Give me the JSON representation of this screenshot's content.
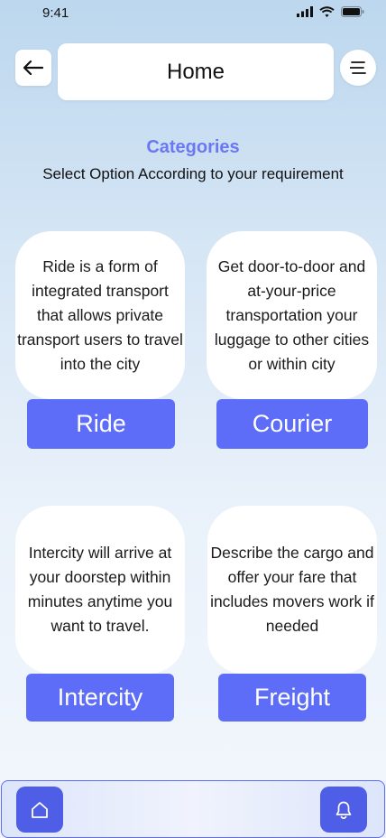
{
  "status_bar": {
    "time": "9:41",
    "icons": [
      "signal-icon",
      "wifi-icon",
      "battery-icon"
    ]
  },
  "header": {
    "title": "Home",
    "back_icon": "arrow-left-icon",
    "menu_icon": "hamburger-menu-icon"
  },
  "categories": {
    "title": "Categories",
    "subtitle": "Select Option According to your requirement",
    "items": [
      {
        "description": "Ride is a form of integrated transport that allows private transport users to travel into the city",
        "button_label": "Ride"
      },
      {
        "description": "Get door-to-door and at-your-price transportation your luggage to other cities or within city",
        "button_label": "Courier"
      },
      {
        "description": "Intercity will arrive at your doorstep within minutes anytime you want to travel.",
        "button_label": "Intercity"
      },
      {
        "description": "Describe the cargo and offer your fare that includes movers work if needed",
        "button_label": "Freight"
      }
    ]
  },
  "bottom_nav": {
    "home_icon": "home-icon",
    "notification_icon": "bell-icon"
  },
  "colors": {
    "accent": "#5d6df8",
    "title_accent": "#6b78f2",
    "nav_button": "#4f5ee6"
  }
}
